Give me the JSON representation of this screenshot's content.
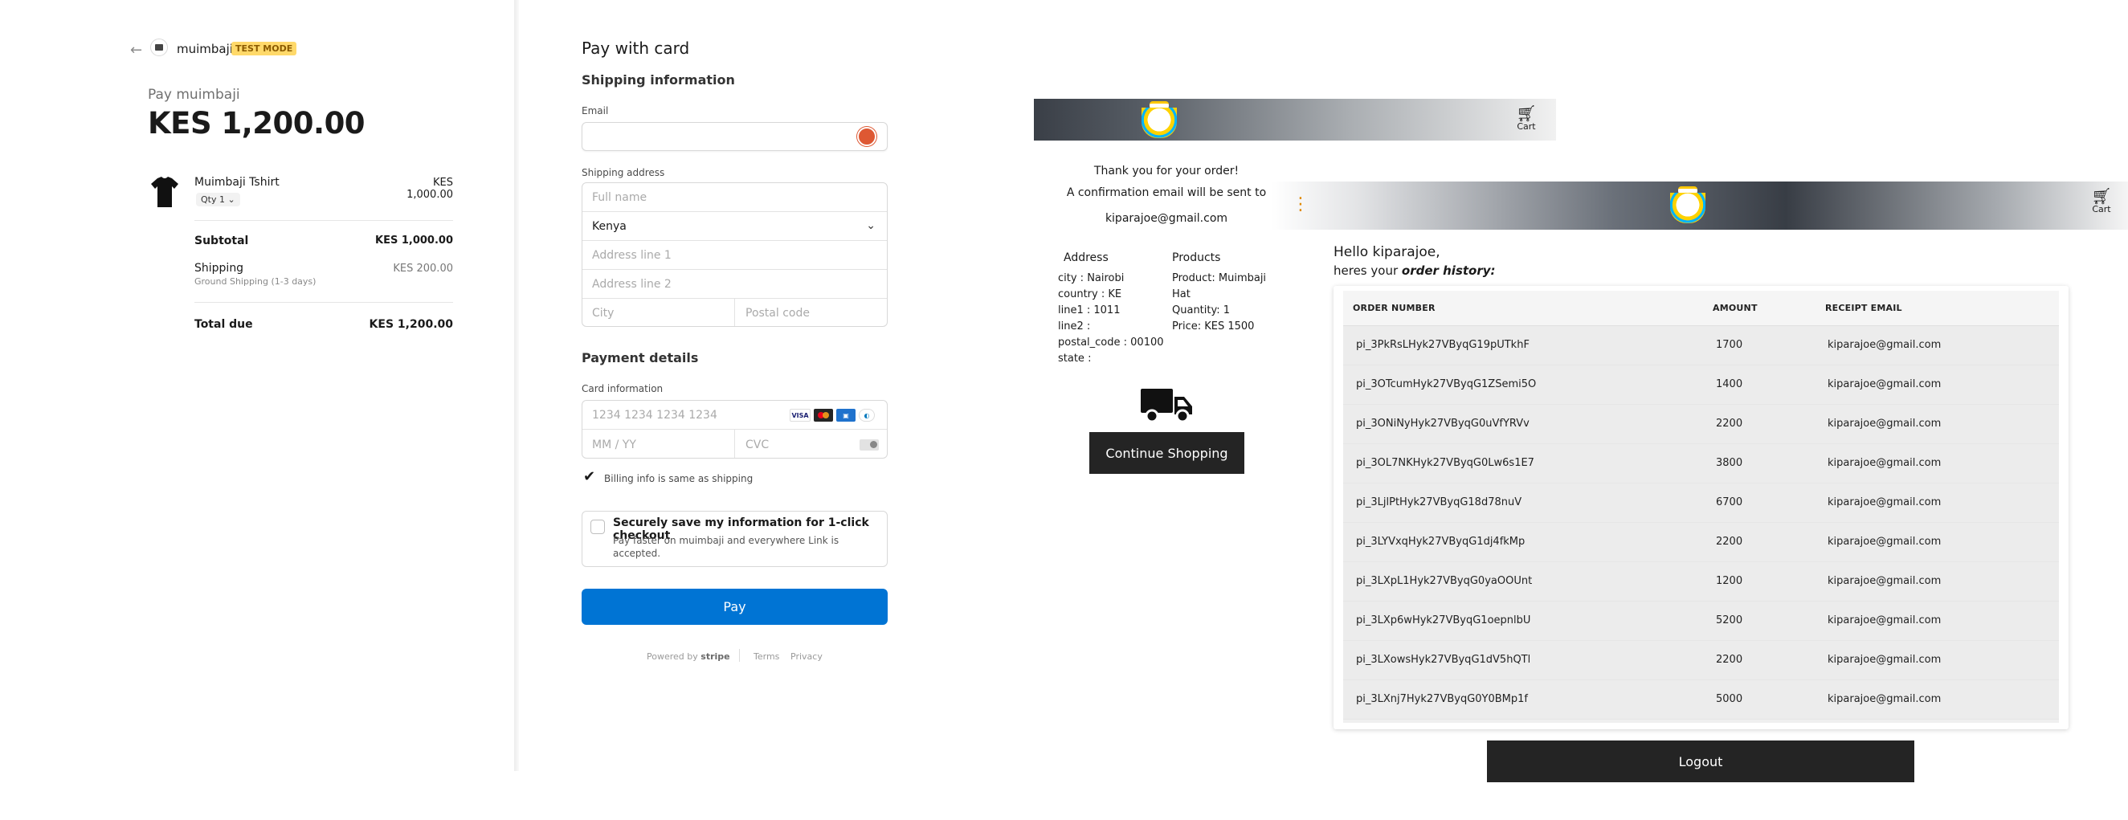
{
  "checkout": {
    "merchant_name": "muimbaji",
    "test_badge": "TEST MODE",
    "pay_label": "Pay muimbaji",
    "pay_amount": "KES 1,200.00",
    "product": {
      "name": "Muimbaji Tshirt",
      "qty": "Qty 1",
      "price": "KES 1,000.00"
    },
    "subtotal_label": "Subtotal",
    "subtotal_value": "KES 1,000.00",
    "shipping_label": "Shipping",
    "shipping_method": "Ground Shipping (1-3 days)",
    "shipping_value": "KES 200.00",
    "total_label": "Total due",
    "total_value": "KES 1,200.00"
  },
  "form": {
    "title": "Pay with card",
    "shipping_heading": "Shipping information",
    "email_label": "Email",
    "email_value": "",
    "shipping_address_label": "Shipping address",
    "full_name_placeholder": "Full name",
    "country_value": "Kenya",
    "address1_placeholder": "Address line 1",
    "address2_placeholder": "Address line 2",
    "city_placeholder": "City",
    "postal_placeholder": "Postal code",
    "payment_heading": "Payment details",
    "card_info_label": "Card information",
    "card_number_placeholder": "1234 1234 1234 1234",
    "expiry_placeholder": "MM / YY",
    "cvc_placeholder": "CVC",
    "card_brands": [
      "VISA",
      "mastercard",
      "AMEX",
      "diners"
    ],
    "billing_same_checked": true,
    "billing_same_label": "Billing info is same as shipping",
    "link_title": "Securely save my information for 1-click checkout",
    "link_subtitle": "Pay faster on muimbaji and everywhere Link is accepted.",
    "pay_button": "Pay",
    "powered_by": "Powered by",
    "stripe_word": "stripe",
    "terms": "Terms",
    "privacy": "Privacy",
    "accent_color": "#0074d4"
  },
  "thankyou": {
    "cart_label": "Cart",
    "message1": "Thank you for your order!",
    "message2": "A confirmation email will be sent to",
    "email": "kiparajoe@gmail.com",
    "address_heading": "Address",
    "products_heading": "Products",
    "address_lines": [
      "city : Nairobi",
      "country : KE",
      "line1 : 1011",
      "line2 :",
      "postal_code : 00100",
      "state :"
    ],
    "product_lines": [
      "Product: Muimbaji",
      "Hat",
      "Quantity: 1",
      "Price: KES 1500"
    ],
    "continue_button": "Continue Shopping",
    "truck_icon": "truck-icon"
  },
  "history": {
    "cart_label": "Cart",
    "hello": "Hello kiparajoe,",
    "heres_prefix": "heres your ",
    "heres_emphasis": "order history:",
    "columns": [
      "ORDER NUMBER",
      "AMOUNT",
      "RECEIPT EMAIL"
    ],
    "rows": [
      [
        "pi_3PkRsLHyk27VByqG19pUTkhF",
        "1700",
        "kiparajoe@gmail.com"
      ],
      [
        "pi_3OTcumHyk27VByqG1ZSemi5O",
        "1400",
        "kiparajoe@gmail.com"
      ],
      [
        "pi_3ONiNyHyk27VByqG0uVfYRVv",
        "2200",
        "kiparajoe@gmail.com"
      ],
      [
        "pi_3OL7NKHyk27VByqG0Lw6s1E7",
        "3800",
        "kiparajoe@gmail.com"
      ],
      [
        "pi_3LjlPtHyk27VByqG18d78nuV",
        "6700",
        "kiparajoe@gmail.com"
      ],
      [
        "pi_3LYVxqHyk27VByqG1dj4fkMp",
        "2200",
        "kiparajoe@gmail.com"
      ],
      [
        "pi_3LXpL1Hyk27VByqG0yaOOUnt",
        "1200",
        "kiparajoe@gmail.com"
      ],
      [
        "pi_3LXp6wHyk27VByqG1oepnlbU",
        "5200",
        "kiparajoe@gmail.com"
      ],
      [
        "pi_3LXowsHyk27VByqG1dV5hQTl",
        "2200",
        "kiparajoe@gmail.com"
      ],
      [
        "pi_3LXnj7Hyk27VByqG0Y0BMp1f",
        "5000",
        "kiparajoe@gmail.com"
      ]
    ],
    "logout_button": "Logout"
  }
}
